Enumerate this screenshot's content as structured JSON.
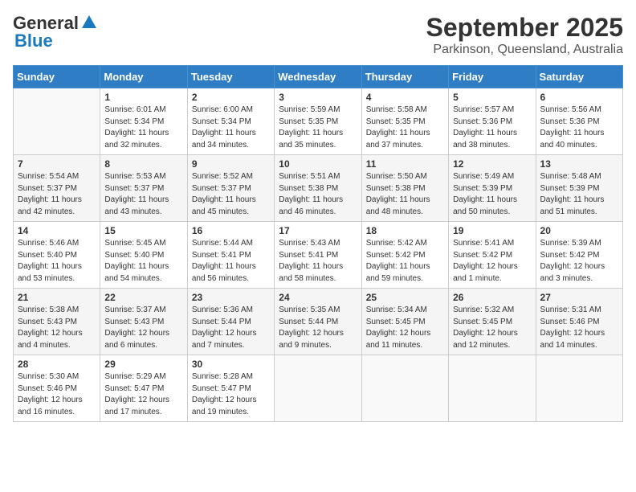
{
  "logo": {
    "line1": "General",
    "line2": "Blue"
  },
  "title": "September 2025",
  "subtitle": "Parkinson, Queensland, Australia",
  "days_of_week": [
    "Sunday",
    "Monday",
    "Tuesday",
    "Wednesday",
    "Thursday",
    "Friday",
    "Saturday"
  ],
  "weeks": [
    [
      {
        "day": "",
        "sunrise": "",
        "sunset": "",
        "daylight": ""
      },
      {
        "day": "1",
        "sunrise": "Sunrise: 6:01 AM",
        "sunset": "Sunset: 5:34 PM",
        "daylight": "Daylight: 11 hours and 32 minutes."
      },
      {
        "day": "2",
        "sunrise": "Sunrise: 6:00 AM",
        "sunset": "Sunset: 5:34 PM",
        "daylight": "Daylight: 11 hours and 34 minutes."
      },
      {
        "day": "3",
        "sunrise": "Sunrise: 5:59 AM",
        "sunset": "Sunset: 5:35 PM",
        "daylight": "Daylight: 11 hours and 35 minutes."
      },
      {
        "day": "4",
        "sunrise": "Sunrise: 5:58 AM",
        "sunset": "Sunset: 5:35 PM",
        "daylight": "Daylight: 11 hours and 37 minutes."
      },
      {
        "day": "5",
        "sunrise": "Sunrise: 5:57 AM",
        "sunset": "Sunset: 5:36 PM",
        "daylight": "Daylight: 11 hours and 38 minutes."
      },
      {
        "day": "6",
        "sunrise": "Sunrise: 5:56 AM",
        "sunset": "Sunset: 5:36 PM",
        "daylight": "Daylight: 11 hours and 40 minutes."
      }
    ],
    [
      {
        "day": "7",
        "sunrise": "Sunrise: 5:54 AM",
        "sunset": "Sunset: 5:37 PM",
        "daylight": "Daylight: 11 hours and 42 minutes."
      },
      {
        "day": "8",
        "sunrise": "Sunrise: 5:53 AM",
        "sunset": "Sunset: 5:37 PM",
        "daylight": "Daylight: 11 hours and 43 minutes."
      },
      {
        "day": "9",
        "sunrise": "Sunrise: 5:52 AM",
        "sunset": "Sunset: 5:37 PM",
        "daylight": "Daylight: 11 hours and 45 minutes."
      },
      {
        "day": "10",
        "sunrise": "Sunrise: 5:51 AM",
        "sunset": "Sunset: 5:38 PM",
        "daylight": "Daylight: 11 hours and 46 minutes."
      },
      {
        "day": "11",
        "sunrise": "Sunrise: 5:50 AM",
        "sunset": "Sunset: 5:38 PM",
        "daylight": "Daylight: 11 hours and 48 minutes."
      },
      {
        "day": "12",
        "sunrise": "Sunrise: 5:49 AM",
        "sunset": "Sunset: 5:39 PM",
        "daylight": "Daylight: 11 hours and 50 minutes."
      },
      {
        "day": "13",
        "sunrise": "Sunrise: 5:48 AM",
        "sunset": "Sunset: 5:39 PM",
        "daylight": "Daylight: 11 hours and 51 minutes."
      }
    ],
    [
      {
        "day": "14",
        "sunrise": "Sunrise: 5:46 AM",
        "sunset": "Sunset: 5:40 PM",
        "daylight": "Daylight: 11 hours and 53 minutes."
      },
      {
        "day": "15",
        "sunrise": "Sunrise: 5:45 AM",
        "sunset": "Sunset: 5:40 PM",
        "daylight": "Daylight: 11 hours and 54 minutes."
      },
      {
        "day": "16",
        "sunrise": "Sunrise: 5:44 AM",
        "sunset": "Sunset: 5:41 PM",
        "daylight": "Daylight: 11 hours and 56 minutes."
      },
      {
        "day": "17",
        "sunrise": "Sunrise: 5:43 AM",
        "sunset": "Sunset: 5:41 PM",
        "daylight": "Daylight: 11 hours and 58 minutes."
      },
      {
        "day": "18",
        "sunrise": "Sunrise: 5:42 AM",
        "sunset": "Sunset: 5:42 PM",
        "daylight": "Daylight: 11 hours and 59 minutes."
      },
      {
        "day": "19",
        "sunrise": "Sunrise: 5:41 AM",
        "sunset": "Sunset: 5:42 PM",
        "daylight": "Daylight: 12 hours and 1 minute."
      },
      {
        "day": "20",
        "sunrise": "Sunrise: 5:39 AM",
        "sunset": "Sunset: 5:42 PM",
        "daylight": "Daylight: 12 hours and 3 minutes."
      }
    ],
    [
      {
        "day": "21",
        "sunrise": "Sunrise: 5:38 AM",
        "sunset": "Sunset: 5:43 PM",
        "daylight": "Daylight: 12 hours and 4 minutes."
      },
      {
        "day": "22",
        "sunrise": "Sunrise: 5:37 AM",
        "sunset": "Sunset: 5:43 PM",
        "daylight": "Daylight: 12 hours and 6 minutes."
      },
      {
        "day": "23",
        "sunrise": "Sunrise: 5:36 AM",
        "sunset": "Sunset: 5:44 PM",
        "daylight": "Daylight: 12 hours and 7 minutes."
      },
      {
        "day": "24",
        "sunrise": "Sunrise: 5:35 AM",
        "sunset": "Sunset: 5:44 PM",
        "daylight": "Daylight: 12 hours and 9 minutes."
      },
      {
        "day": "25",
        "sunrise": "Sunrise: 5:34 AM",
        "sunset": "Sunset: 5:45 PM",
        "daylight": "Daylight: 12 hours and 11 minutes."
      },
      {
        "day": "26",
        "sunrise": "Sunrise: 5:32 AM",
        "sunset": "Sunset: 5:45 PM",
        "daylight": "Daylight: 12 hours and 12 minutes."
      },
      {
        "day": "27",
        "sunrise": "Sunrise: 5:31 AM",
        "sunset": "Sunset: 5:46 PM",
        "daylight": "Daylight: 12 hours and 14 minutes."
      }
    ],
    [
      {
        "day": "28",
        "sunrise": "Sunrise: 5:30 AM",
        "sunset": "Sunset: 5:46 PM",
        "daylight": "Daylight: 12 hours and 16 minutes."
      },
      {
        "day": "29",
        "sunrise": "Sunrise: 5:29 AM",
        "sunset": "Sunset: 5:47 PM",
        "daylight": "Daylight: 12 hours and 17 minutes."
      },
      {
        "day": "30",
        "sunrise": "Sunrise: 5:28 AM",
        "sunset": "Sunset: 5:47 PM",
        "daylight": "Daylight: 12 hours and 19 minutes."
      },
      {
        "day": "",
        "sunrise": "",
        "sunset": "",
        "daylight": ""
      },
      {
        "day": "",
        "sunrise": "",
        "sunset": "",
        "daylight": ""
      },
      {
        "day": "",
        "sunrise": "",
        "sunset": "",
        "daylight": ""
      },
      {
        "day": "",
        "sunrise": "",
        "sunset": "",
        "daylight": ""
      }
    ]
  ]
}
